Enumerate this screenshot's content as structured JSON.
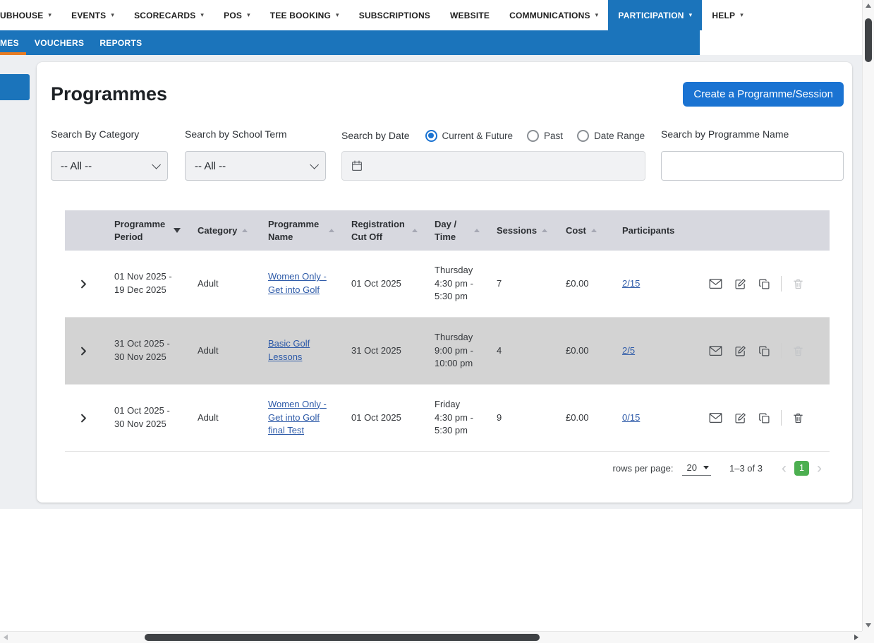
{
  "colors": {
    "nav_blue": "#1b74bb",
    "button_blue": "#1a73d2",
    "accent_orange": "#e87c23",
    "page_green": "#4caf50",
    "link_blue": "#2d5aa8",
    "row_highlight": "#d3d3d3"
  },
  "icons": {
    "caret_down": "▾",
    "chevron_left": "‹",
    "chevron_right": "›"
  },
  "topnav": {
    "items": [
      {
        "label": "UBHOUSE"
      },
      {
        "label": "EVENTS"
      },
      {
        "label": "SCORECARDS"
      },
      {
        "label": "POS"
      },
      {
        "label": "TEE BOOKING"
      },
      {
        "label": "SUBSCRIPTIONS"
      },
      {
        "label": "WEBSITE"
      },
      {
        "label": "COMMUNICATIONS"
      },
      {
        "label": "PARTICIPATION"
      },
      {
        "label": "HELP"
      }
    ]
  },
  "subnav": {
    "items": [
      {
        "label": "MES"
      },
      {
        "label": "VOUCHERS"
      },
      {
        "label": "REPORTS"
      }
    ]
  },
  "page": {
    "title": "Programmes",
    "create_button": "Create a Programme/Session"
  },
  "filters": {
    "category_label": "Search By Category",
    "category_value": "-- All --",
    "term_label": "Search by School Term",
    "term_value": "-- All --",
    "date_label": "Search by Date",
    "date_options": [
      {
        "label": "Current & Future",
        "selected": true
      },
      {
        "label": "Past",
        "selected": false
      },
      {
        "label": "Date Range",
        "selected": false
      }
    ],
    "name_label": "Search by Programme Name"
  },
  "table": {
    "headers": {
      "period": "Programme Period",
      "category": "Category",
      "name": "Programme Name",
      "cutoff": "Registration Cut Off",
      "daytime": "Day / Time",
      "sessions": "Sessions",
      "cost": "Cost",
      "participants": "Participants"
    },
    "rows": [
      {
        "period": "01 Nov 2025 - 19 Dec 2025",
        "category": "Adult",
        "name": "Women Only - Get into Golf",
        "cutoff": "01 Oct 2025",
        "daytime": "Thursday 4:30 pm - 5:30 pm",
        "sessions": "7",
        "cost": "£0.00",
        "participants": "2/15"
      },
      {
        "period": "31 Oct 2025 - 30 Nov 2025",
        "category": "Adult",
        "name": "Basic Golf Lessons",
        "cutoff": "31 Oct 2025",
        "daytime": "Thursday 9:00 pm - 10:00 pm",
        "sessions": "4",
        "cost": "£0.00",
        "participants": "2/5"
      },
      {
        "period": "01 Oct 2025 - 30 Nov 2025",
        "category": "Adult",
        "name": "Women Only - Get into Golf final Test",
        "cutoff": "01 Oct 2025",
        "daytime": "Friday 4:30 pm - 5:30 pm",
        "sessions": "9",
        "cost": "£0.00",
        "participants": "0/15"
      }
    ],
    "footer": {
      "rows_per_page_label": "rows per page:",
      "rows_per_page_value": "20",
      "range": "1–3 of 3",
      "page": "1"
    }
  }
}
